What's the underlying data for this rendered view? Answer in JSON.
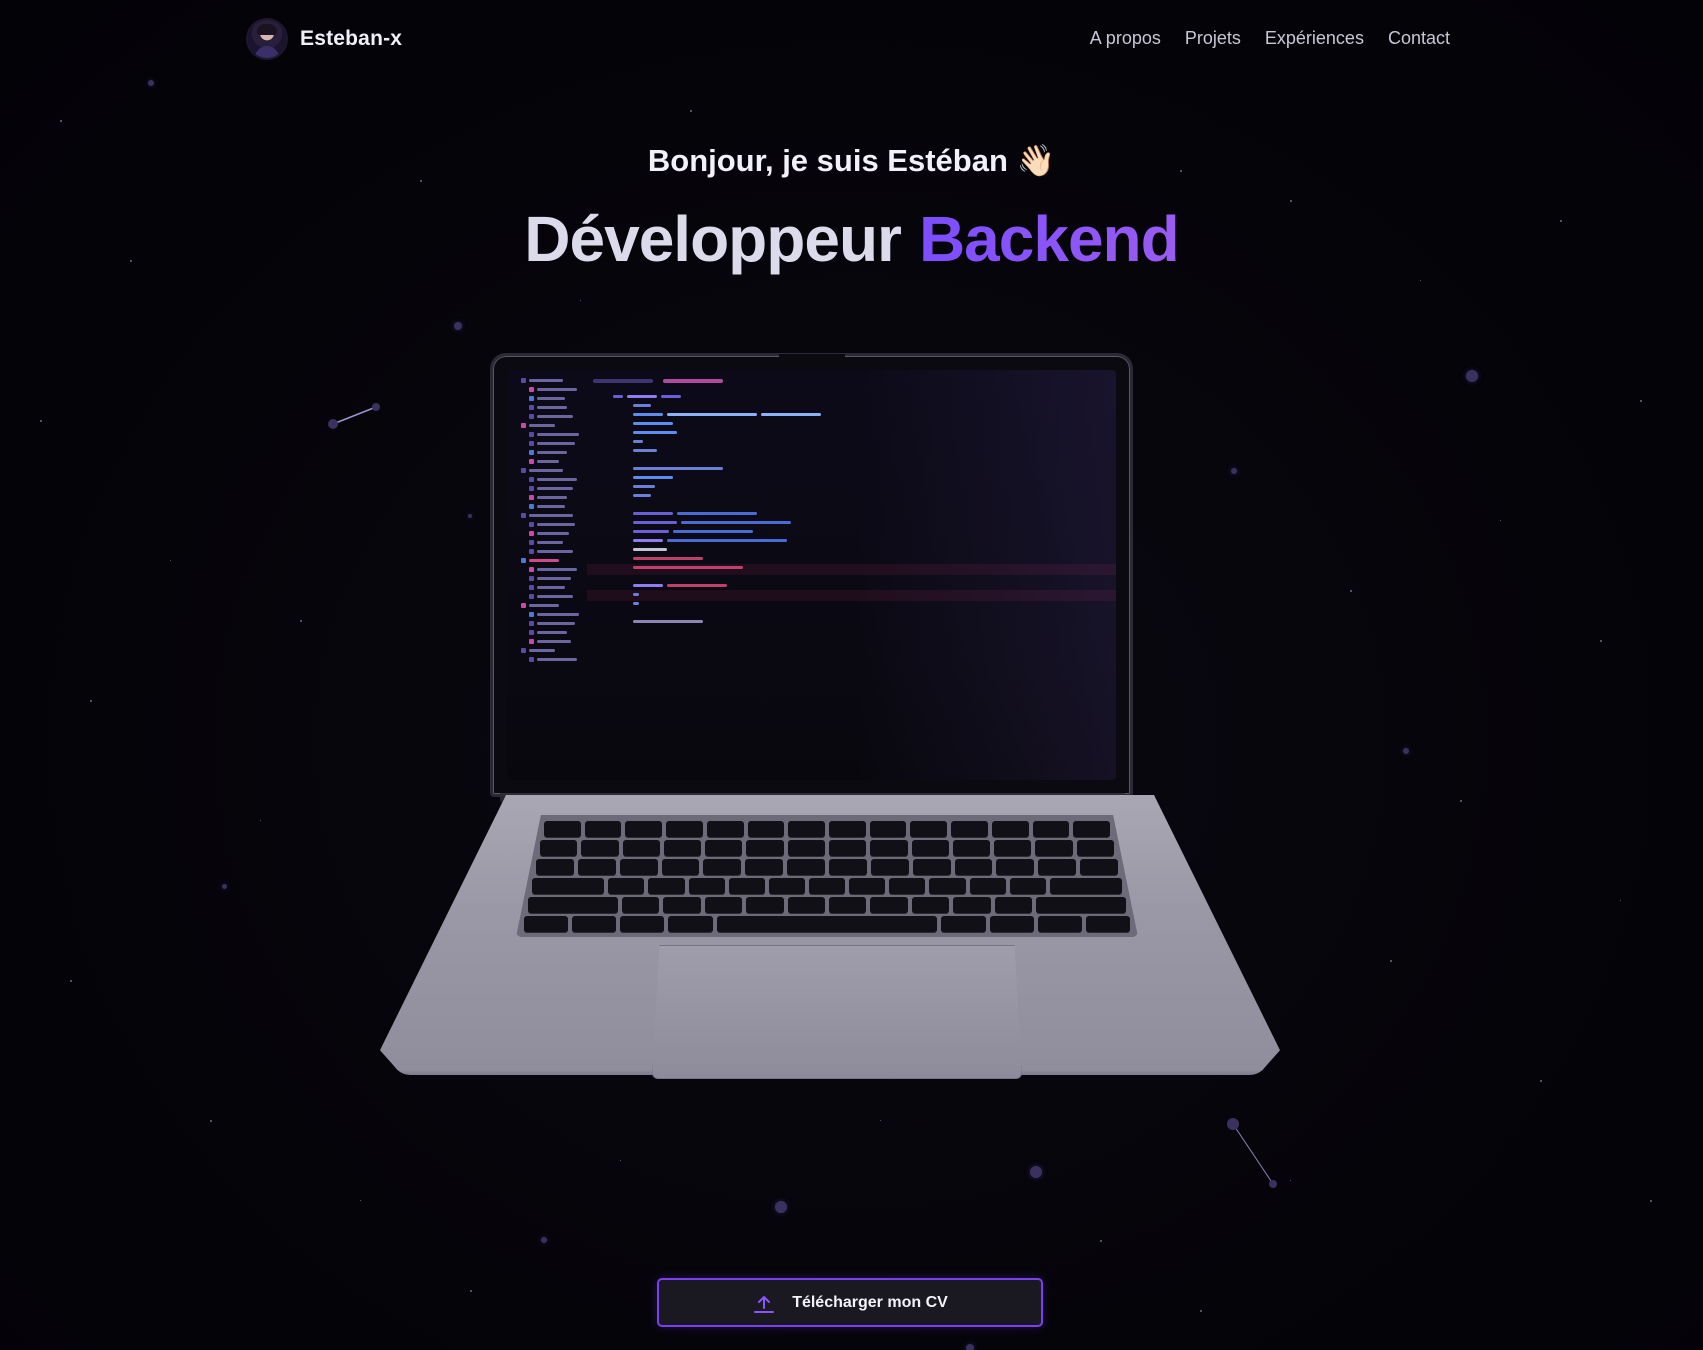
{
  "header": {
    "brand": "Esteban-x",
    "nav": [
      "A propos",
      "Projets",
      "Expériences",
      "Contact"
    ]
  },
  "hero": {
    "greeting": "Bonjour, je suis Estéban 👋🏻",
    "title_part1": "Développeur",
    "title_part2": "Backend"
  },
  "cta": {
    "label": "Télécharger mon CV"
  },
  "colors": {
    "accent": "#7b4dff",
    "background": "#050409",
    "button_border": "#7b3ff2"
  },
  "icons": [
    "avatar",
    "upload-icon",
    "laptop-illustration"
  ]
}
